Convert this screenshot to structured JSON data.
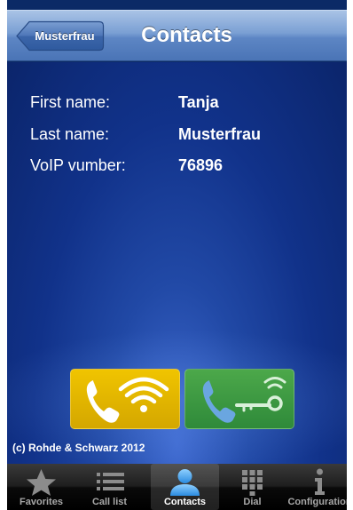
{
  "navbar": {
    "back_label": "Musterfrau",
    "title": "Contacts"
  },
  "contact": {
    "fields": [
      {
        "label": "First name:",
        "value": "Tanja"
      },
      {
        "label": "Last name:",
        "value": "Musterfrau"
      },
      {
        "label": "VoIP vumber:",
        "value": "76896"
      }
    ]
  },
  "actions": {
    "wifi_call": "phone-wifi-icon",
    "ip_call": "phone-key-icon"
  },
  "footer": {
    "copyright": "(c) Rohde & Schwarz 2012"
  },
  "tabs": [
    {
      "label": "Favorites",
      "icon": "star-icon"
    },
    {
      "label": "Call list",
      "icon": "list-icon"
    },
    {
      "label": "Contacts",
      "icon": "person-icon",
      "active": true
    },
    {
      "label": "Dial",
      "icon": "keypad-icon"
    },
    {
      "label": "Configuration",
      "icon": "info-icon"
    }
  ],
  "colors": {
    "wifi_button": "#d4a700",
    "ip_button": "#2f8a3a",
    "navbar": "#5d86c4",
    "background": "#0b2a66"
  }
}
